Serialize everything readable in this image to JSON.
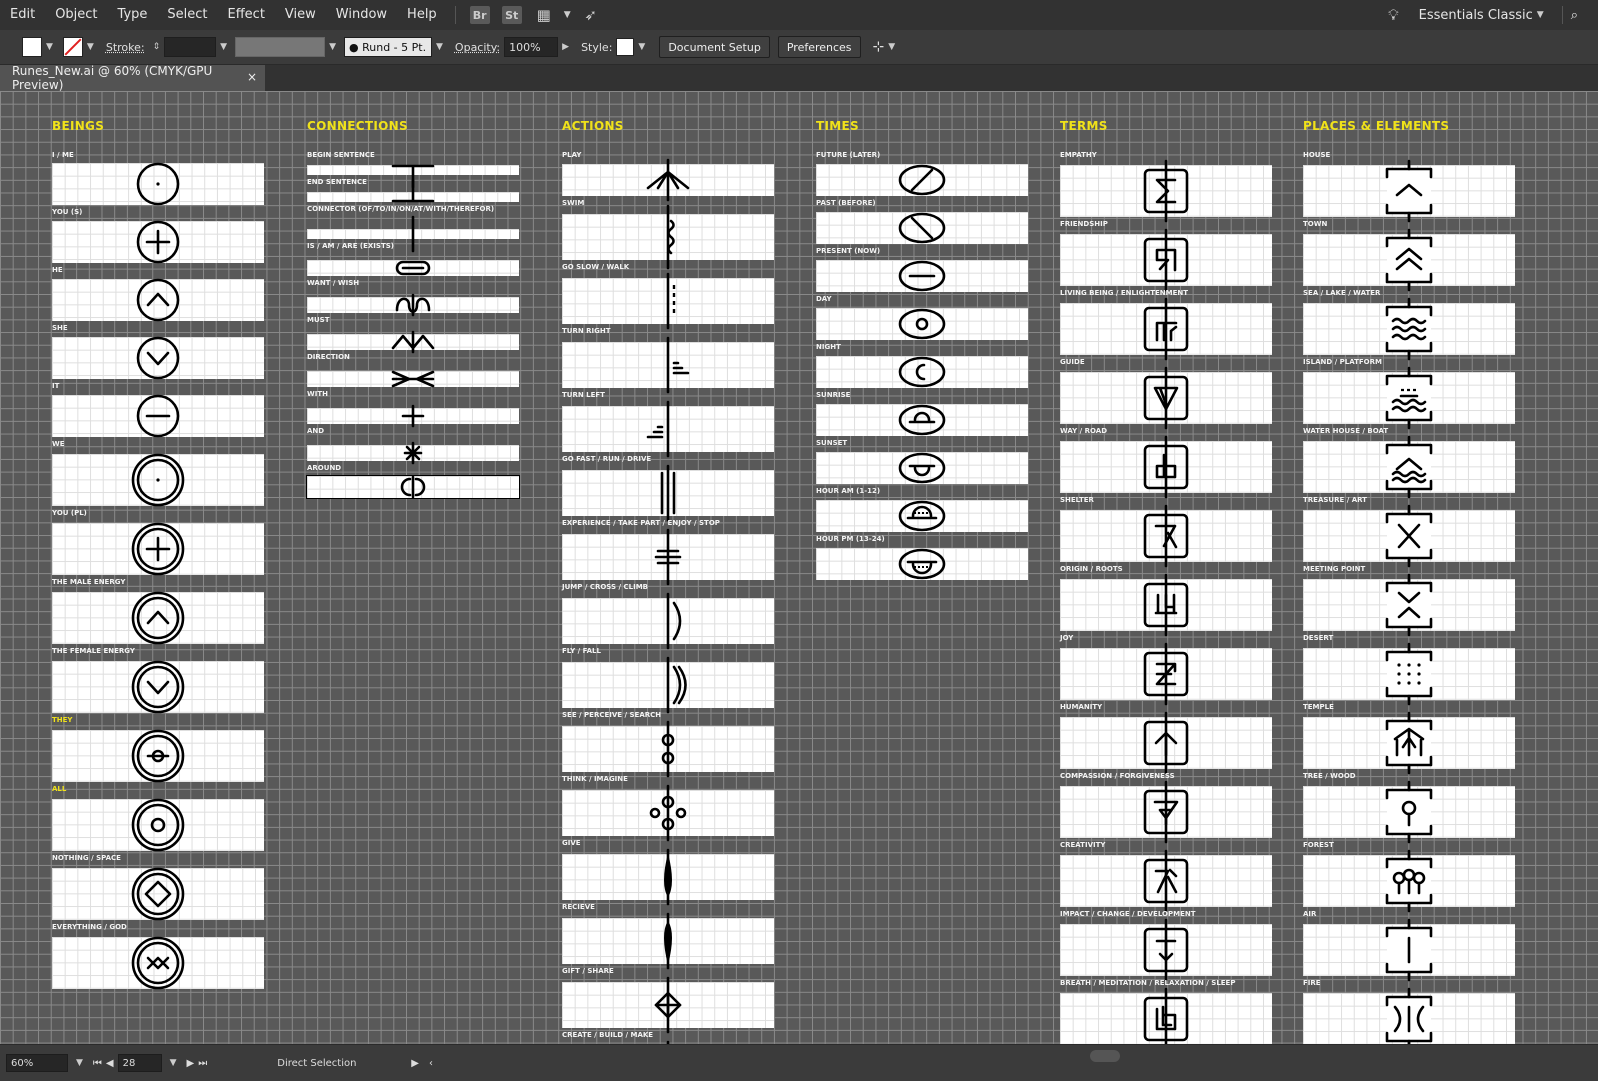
{
  "menu": {
    "items": [
      "Edit",
      "Object",
      "Type",
      "Select",
      "Effect",
      "View",
      "Window",
      "Help"
    ],
    "bridge": "Br",
    "stock": "St",
    "workspace": "Essentials Classic"
  },
  "control": {
    "stroke_label": "Stroke:",
    "brush": "Rund - 5 Pt.",
    "opacity_label": "Opacity:",
    "opacity_value": "100%",
    "style_label": "Style:",
    "document_setup": "Document Setup",
    "preferences": "Preferences"
  },
  "tab": {
    "title": "Runes_New.ai @ 60% (CMYK/GPU Preview)",
    "close": "×"
  },
  "status": {
    "zoom": "60%",
    "page": "28",
    "tool": "Direct Selection"
  },
  "columns": [
    {
      "title": "BEINGS",
      "items": [
        {
          "label": "I / ME",
          "glyph": "dot"
        },
        {
          "label": "YOU (S)",
          "glyph": "plus"
        },
        {
          "label": "HE",
          "glyph": "up"
        },
        {
          "label": "SHE",
          "glyph": "down"
        },
        {
          "label": "IT",
          "glyph": "minus"
        },
        {
          "label": "WE",
          "glyph": "dot2"
        },
        {
          "label": "YOU (PL)",
          "glyph": "plus2"
        },
        {
          "label": "THE MALE ENERGY",
          "glyph": "up2"
        },
        {
          "label": "THE FEMALE ENERGY",
          "glyph": "down2"
        },
        {
          "label": "THEY",
          "glyph": "ring-line",
          "highlight": true
        },
        {
          "label": "ALL",
          "glyph": "ring-ring",
          "highlight": true
        },
        {
          "label": "NOTHING / SPACE",
          "glyph": "diamond2"
        },
        {
          "label": "EVERYTHING / GOD",
          "glyph": "xx2"
        }
      ]
    },
    {
      "title": "CONNECTIONS",
      "items": [
        {
          "label": "BEGIN SENTENCE",
          "glyph": "begin"
        },
        {
          "label": "END SENTENCE",
          "glyph": "end"
        },
        {
          "label": "CONNECTOR (OF/TO/IN/ON/AT/WITH/THEREFOR)",
          "glyph": "connector"
        },
        {
          "label": "IS / AM / ARE (EXISTS)",
          "glyph": "is"
        },
        {
          "label": "WANT / WISH",
          "glyph": "want"
        },
        {
          "label": "MUST",
          "glyph": "must"
        },
        {
          "label": "DIRECTION",
          "glyph": "direction"
        },
        {
          "label": "WITH",
          "glyph": "with"
        },
        {
          "label": "AND",
          "glyph": "and"
        },
        {
          "label": "AROUND",
          "glyph": "around"
        }
      ]
    },
    {
      "title": "ACTIONS",
      "items": [
        {
          "label": "PLAY",
          "glyph": "play"
        },
        {
          "label": "SWIM",
          "glyph": "swim"
        },
        {
          "label": "GO SLOW / WALK",
          "glyph": "walk"
        },
        {
          "label": "TURN RIGHT",
          "glyph": "turnright"
        },
        {
          "label": "TURN LEFT",
          "glyph": "turnleft"
        },
        {
          "label": "GO FAST / RUN / DRIVE",
          "glyph": "run"
        },
        {
          "label": "EXPERIENCE / TAKE PART / ENJOY / STOP",
          "glyph": "stop"
        },
        {
          "label": "JUMP / CROSS / CLIMB",
          "glyph": "jump"
        },
        {
          "label": "FLY / FALL",
          "glyph": "fly"
        },
        {
          "label": "SEE / PERCEIVE / SEARCH",
          "glyph": "see"
        },
        {
          "label": "THINK / IMAGINE",
          "glyph": "think"
        },
        {
          "label": "GIVE",
          "glyph": "give"
        },
        {
          "label": "RECIEVE",
          "glyph": "recieve"
        },
        {
          "label": "GIFT / SHARE",
          "glyph": "gift"
        },
        {
          "label": "CREATE / BUILD / MAKE",
          "glyph": "create"
        }
      ]
    },
    {
      "title": "TIMES",
      "items": [
        {
          "label": "FUTURE (LATER)",
          "glyph": "future"
        },
        {
          "label": "PAST (BEFORE)",
          "glyph": "past"
        },
        {
          "label": "PRESENT (NOW)",
          "glyph": "present"
        },
        {
          "label": "DAY",
          "glyph": "day"
        },
        {
          "label": "NIGHT",
          "glyph": "night"
        },
        {
          "label": "SUNRISE",
          "glyph": "sunrise"
        },
        {
          "label": "SUNSET",
          "glyph": "sunset"
        },
        {
          "label": "HOUR AM (1-12)",
          "glyph": "houram"
        },
        {
          "label": "HOUR PM (13-24)",
          "glyph": "hourpm"
        }
      ]
    },
    {
      "title": "TERMS",
      "items": [
        {
          "label": "EMPATHY",
          "glyph": "empathy"
        },
        {
          "label": "FRIENDSHIP",
          "glyph": "friendship"
        },
        {
          "label": "LIVING BEING / ENLIGHTENMENT",
          "glyph": "living"
        },
        {
          "label": "GUIDE",
          "glyph": "guide"
        },
        {
          "label": "WAY / ROAD",
          "glyph": "way"
        },
        {
          "label": "SHELTER",
          "glyph": "shelter"
        },
        {
          "label": "ORIGIN / ROOTS",
          "glyph": "origin"
        },
        {
          "label": "JOY",
          "glyph": "joy"
        },
        {
          "label": "HUMANITY",
          "glyph": "humanity"
        },
        {
          "label": "COMPASSION / FORGIVENESS",
          "glyph": "compassion"
        },
        {
          "label": "CREATIVITY",
          "glyph": "creativity"
        },
        {
          "label": "IMPACT / CHANGE / DEVELOPMENT",
          "glyph": "impact"
        },
        {
          "label": "BREATH / MEDITATION / RELAXATION / SLEEP",
          "glyph": "breath"
        }
      ]
    },
    {
      "title": "PLACES & ELEMENTS",
      "items": [
        {
          "label": "HOUSE",
          "glyph": "house"
        },
        {
          "label": "TOWN",
          "glyph": "town"
        },
        {
          "label": "SEA / LAKE / WATER",
          "glyph": "sea"
        },
        {
          "label": "ISLAND / PLATFORM",
          "glyph": "island"
        },
        {
          "label": "WATER HOUSE / BOAT",
          "glyph": "boat"
        },
        {
          "label": "TREASURE / ART",
          "glyph": "treasure"
        },
        {
          "label": "MEETING POINT",
          "glyph": "meeting"
        },
        {
          "label": "DESERT",
          "glyph": "desert"
        },
        {
          "label": "TEMPLE",
          "glyph": "temple"
        },
        {
          "label": "TREE / WOOD",
          "glyph": "tree"
        },
        {
          "label": "FOREST",
          "glyph": "forest"
        },
        {
          "label": "AIR",
          "glyph": "air"
        },
        {
          "label": "FIRE",
          "glyph": "fire"
        }
      ]
    }
  ]
}
